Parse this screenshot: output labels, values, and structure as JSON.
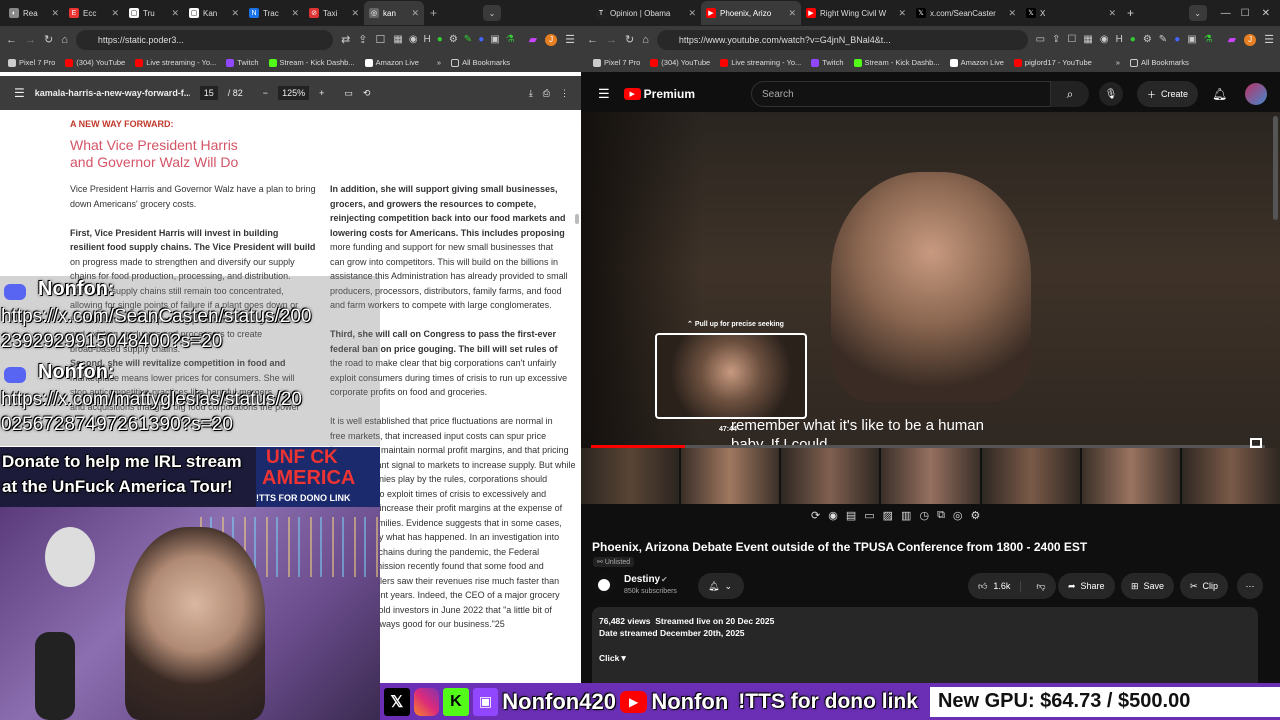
{
  "left_browser": {
    "tabs": [
      "Rea",
      "Ecc",
      "Tru",
      "Kan",
      "Trac",
      "Taxi",
      "kan"
    ],
    "url": "https://static.poder3...",
    "bookmarks": [
      "Pixel 7 Pro",
      "(304) YouTube",
      "Live streaming - Yo...",
      "Twitch",
      "Stream - Kick Dashb...",
      "Amazon Live",
      "All Bookmarks"
    ],
    "pdf": {
      "filename": "kamala-harris-a-new-way-forward-f...",
      "page": "15",
      "total": "/ 82",
      "zoom": "125%",
      "heading": "A NEW WAY FORWARD:",
      "subheading_1": "What Vice President Harris",
      "subheading_2": "and Governor Walz Will Do",
      "col1": [
        "Vice President Harris and Governor Walz have a plan to bring",
        "down Americans' grocery costs.",
        "",
        "First, Vice President Harris will invest in building",
        "resilient food supply chains. The Vice President will build",
        "on progress made to strengthen and diversify our supply",
        "chains for food production, processing, and distribution.",
        "Too many supply chains still remain too concentrated,",
        "allowing for single points of failure if a plant goes down or",
        "Harris will focus on expanding production among new",
        "and existing producers and processors to create",
        "broad-based supply chains.",
        "Second, she will revitalize competition in food and",
        "marketplace means lower prices for consumers. She will",
        "stop anticompetitive practices like harmful mergers",
        "and acquisitions that give big food corporations the power"
      ],
      "col2": [
        "In addition, she will support giving small businesses,",
        "grocers, and growers the resources to compete,",
        "reinjecting competition back into our food markets and",
        "lowering costs for Americans. This includes proposing",
        "more funding and support for new small businesses that",
        "can grow into competitors. This will build on the billions in",
        "assistance this Administration has already provided to small",
        "producers, processors, distributors, family farms, and food",
        "and farm workers to compete with large conglomerates.",
        "",
        "Third, she will call on Congress to pass the first-ever",
        "federal ban on price gouging. The bill will set rules of",
        "the road to make clear that big corporations can't unfairly",
        "exploit consumers during times of crisis to run up excessive",
        "corporate profits on food and groceries.",
        "",
        "It is well established that price fluctuations are normal in",
        "free markets, that increased input costs can spur price",
        "increases to maintain normal profit margins, and that pricing",
        "is an important signal to markets to increase supply. But while",
        "most companies play by the rules, corporations should",
        "not be able to exploit times of crisis to excessively and",
        "unjustifiably increase their profit margins at the expense of",
        "American families. Evidence suggests that in some cases,",
        "this is exactly what has happened. In an investigation into",
        "food supply chains during the pandemic, the Federal",
        "Trade Commission recently found that some food and",
        "grocery retailers saw their revenues rise much faster than",
        "costs in recent years. Indeed, the CEO of a major grocery",
        "chain even told investors in June 2022 that \"a little bit of",
        "inflation is always good for our business.\"25"
      ]
    }
  },
  "right_browser": {
    "tabs": [
      "Opinion | Obama",
      "Phoenix, Arizo",
      "Right Wing Civil W",
      "x.com/SeanCaster",
      "X"
    ],
    "url": "https://www.youtube.com/watch?v=G4jnN_BNal4&t...",
    "bookmarks": [
      "Pixel 7 Pro",
      "(304) YouTube",
      "Live streaming - Yo...",
      "Twitch",
      "Stream - Kick Dashb...",
      "Amazon Live",
      "piglord17 - YouTube",
      "All Bookmarks"
    ],
    "youtube": {
      "logo": "Premium",
      "search_placeholder": "Search",
      "create_label": "Create",
      "seek_hint": "Pull up for precise seeking",
      "seek_time": "47:44",
      "caption_line1": "remember what it's like to be a human",
      "caption_line2": "baby. If I could",
      "title": "Phoenix, Arizona Debate Event outside of the TPUSA Conference from 1800 - 2400 EST",
      "unlisted": "Unlisted",
      "channel": "Destiny",
      "subscribers": "850k subscribers",
      "likes": "1.6k",
      "share": "Share",
      "save": "Save",
      "clip": "Clip",
      "views": "76,482 views",
      "streamed": "Streamed live on 20 Dec 2025",
      "date_streamed": "Date streamed December 20th, 2025",
      "click": "Click▼",
      "progress": 0.14
    }
  },
  "stream_overlay": {
    "chat": [
      {
        "user": "Nonfon:",
        "line1": "https://x.com/SeanCasten/status/200",
        "line2": "2392929915048400?s=20"
      },
      {
        "user": "Nonfon:",
        "line1": "https://x.com/mattyglesias/status/20",
        "line2": "02567287497261390?s=20"
      }
    ],
    "donate_line1": "Donate to help me  IRL stream",
    "donate_line2": "at the UnFuck America Tour!",
    "unfuck_1": "UNF CK",
    "unfuck_2": "AMERICA",
    "tts_small": "!TTS FOR DONO LINK",
    "bottom_handle": "Nonfon420",
    "bottom_yt": "Nonfon",
    "bottom_tts": "!TTS for dono link",
    "gpu_goal": "New GPU: $64.73 / $500.00"
  }
}
